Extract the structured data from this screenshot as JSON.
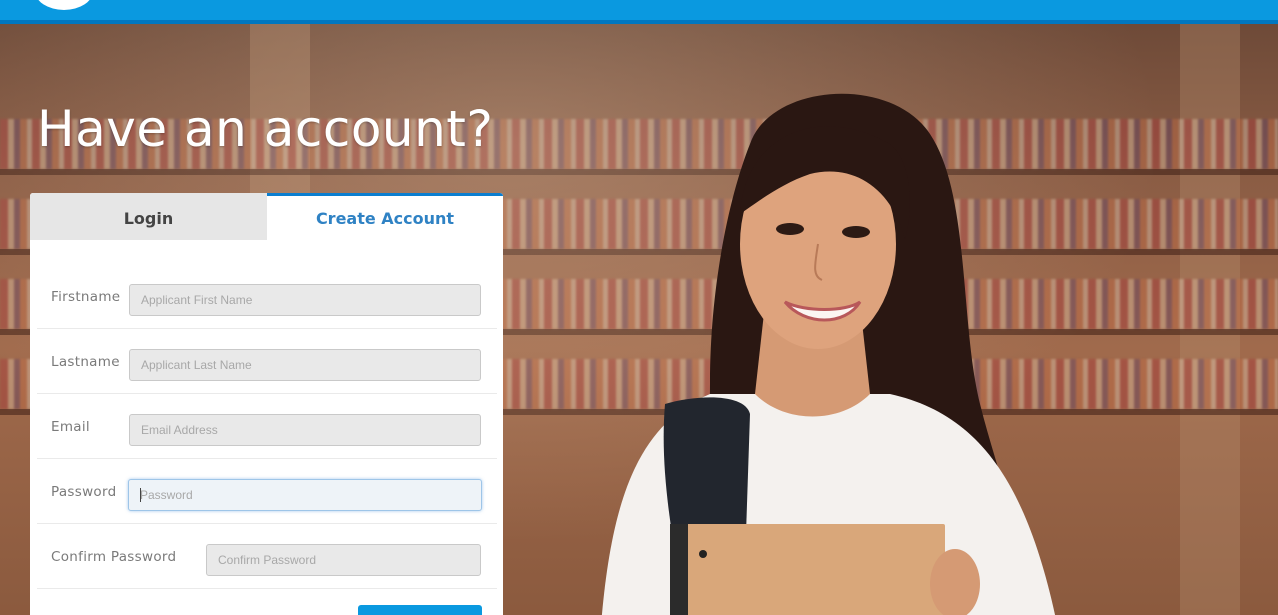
{
  "headline": "Have an account?",
  "tabs": {
    "login": "Login",
    "create_account": "Create Account"
  },
  "form": {
    "fields": [
      {
        "label": "Firstname",
        "placeholder": "Applicant First Name",
        "value": ""
      },
      {
        "label": "Lastname",
        "placeholder": "Applicant Last Name",
        "value": ""
      },
      {
        "label": "Email",
        "placeholder": "Email Address",
        "value": ""
      },
      {
        "label": "Password",
        "placeholder": "Password",
        "value": ""
      },
      {
        "label": "Confirm Password",
        "placeholder": "Confirm Password",
        "value": ""
      }
    ]
  },
  "colors": {
    "topbar": "#0a99e0",
    "active_tab_text": "#2f82c4",
    "button": "#0a99e0"
  }
}
